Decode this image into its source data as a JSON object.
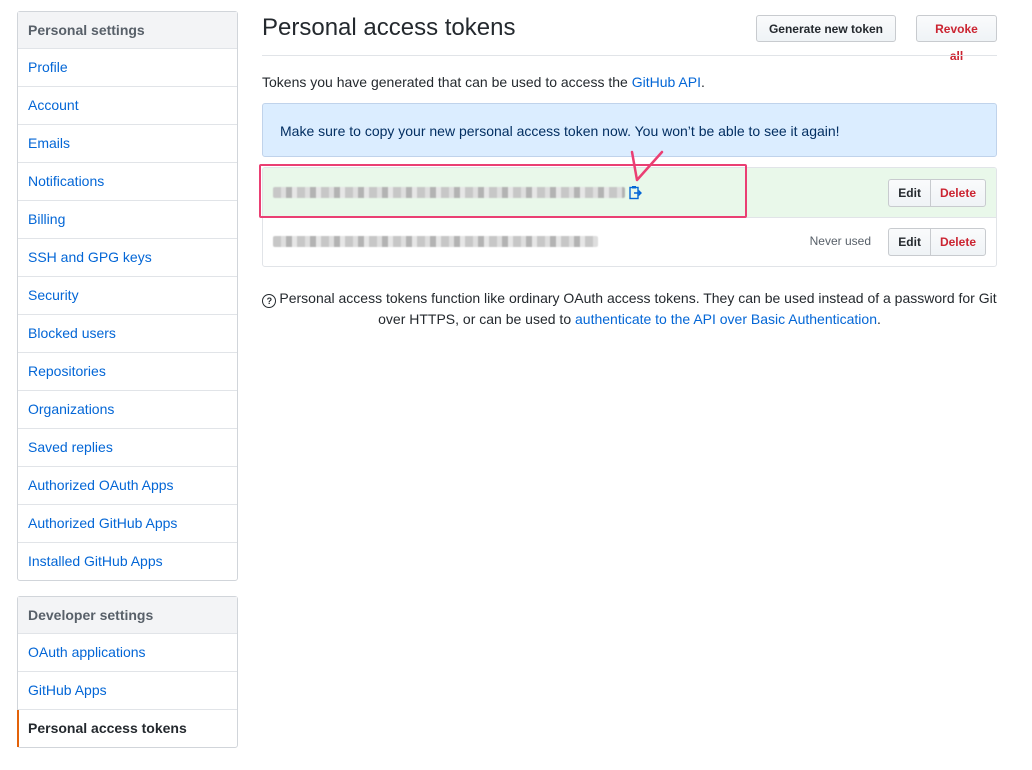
{
  "sidebar": {
    "personal_heading": "Personal settings",
    "personal_items": [
      {
        "label": "Profile"
      },
      {
        "label": "Account"
      },
      {
        "label": "Emails"
      },
      {
        "label": "Notifications"
      },
      {
        "label": "Billing"
      },
      {
        "label": "SSH and GPG keys"
      },
      {
        "label": "Security"
      },
      {
        "label": "Blocked users"
      },
      {
        "label": "Repositories"
      },
      {
        "label": "Organizations"
      },
      {
        "label": "Saved replies"
      },
      {
        "label": "Authorized OAuth Apps"
      },
      {
        "label": "Authorized GitHub Apps"
      },
      {
        "label": "Installed GitHub Apps"
      }
    ],
    "developer_heading": "Developer settings",
    "developer_items": [
      {
        "label": "OAuth applications"
      },
      {
        "label": "GitHub Apps"
      },
      {
        "label": "Personal access tokens",
        "selected": true
      }
    ]
  },
  "main": {
    "title": "Personal access tokens",
    "generate_button": "Generate new token",
    "revoke_button": "Revoke all",
    "intro_text": "Tokens you have generated that can be used to access the ",
    "intro_link": "GitHub API",
    "intro_end": ".",
    "flash": "Make sure to copy your new personal access token now. You won’t be able to see it again!",
    "tokens": [
      {
        "usage": "",
        "edit": "Edit",
        "delete": "Delete",
        "copy_icon": "clippy-icon"
      },
      {
        "usage": "Never used",
        "edit": "Edit",
        "delete": "Delete"
      }
    ],
    "note_text": "Personal access tokens function like ordinary OAuth access tokens. They can be used instead of a password for Git over HTTPS, or can be used to ",
    "note_link": "authenticate to the API over Basic Authentication",
    "note_end": ".",
    "note_icon": "question-icon"
  },
  "colors": {
    "link": "#0366d6",
    "danger": "#cb2431",
    "highlight": "#ea3f73",
    "flash_bg": "#dbedff",
    "new_token_bg": "#e9f8ea",
    "selected_bar": "#e36209"
  }
}
